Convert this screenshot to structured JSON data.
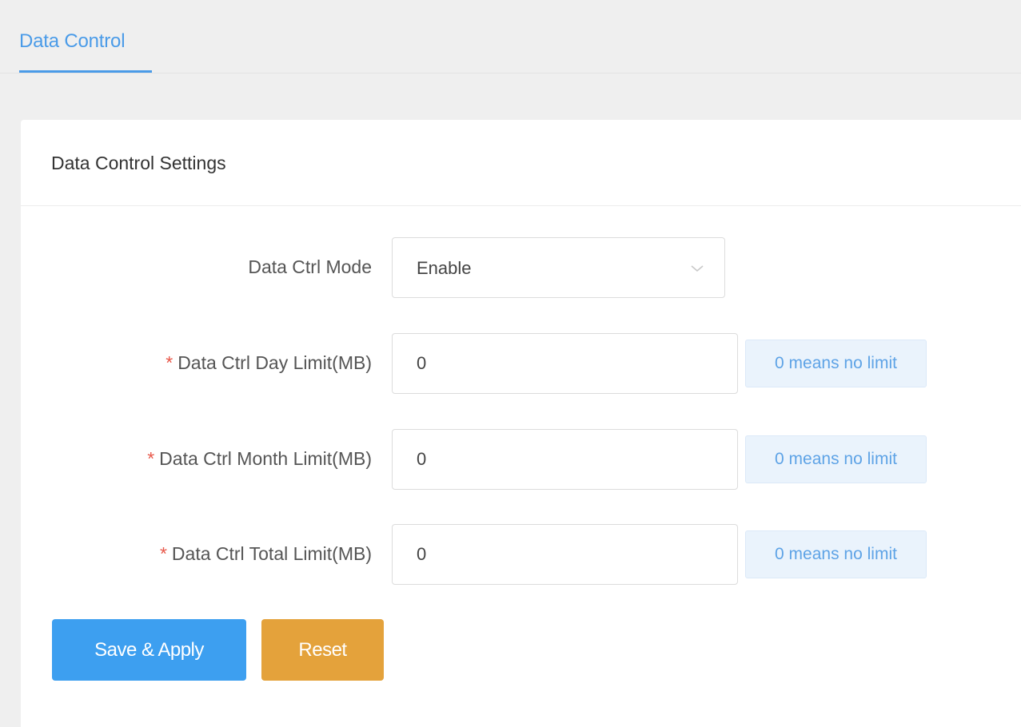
{
  "tabs": [
    {
      "label": "Data Control",
      "active": true
    }
  ],
  "card": {
    "title": "Data Control Settings"
  },
  "form": {
    "mode": {
      "label": "Data Ctrl Mode",
      "value": "Enable"
    },
    "day_limit": {
      "label": "Data Ctrl Day Limit(MB)",
      "required": "*",
      "value": "0",
      "hint": "0 means no limit"
    },
    "month_limit": {
      "label": "Data Ctrl Month Limit(MB)",
      "required": "*",
      "value": "0",
      "hint": "0 means no limit"
    },
    "total_limit": {
      "label": "Data Ctrl Total Limit(MB)",
      "required": "*",
      "value": "0",
      "hint": "0 means no limit"
    }
  },
  "buttons": {
    "save_label": "Save & Apply",
    "reset_label": "Reset"
  },
  "colors": {
    "accent": "#4a9be8",
    "save": "#3d9ff0",
    "reset": "#e4a23b",
    "required": "#e8584a"
  },
  "icons": {
    "select_toggle": "chevron-down-icon"
  }
}
